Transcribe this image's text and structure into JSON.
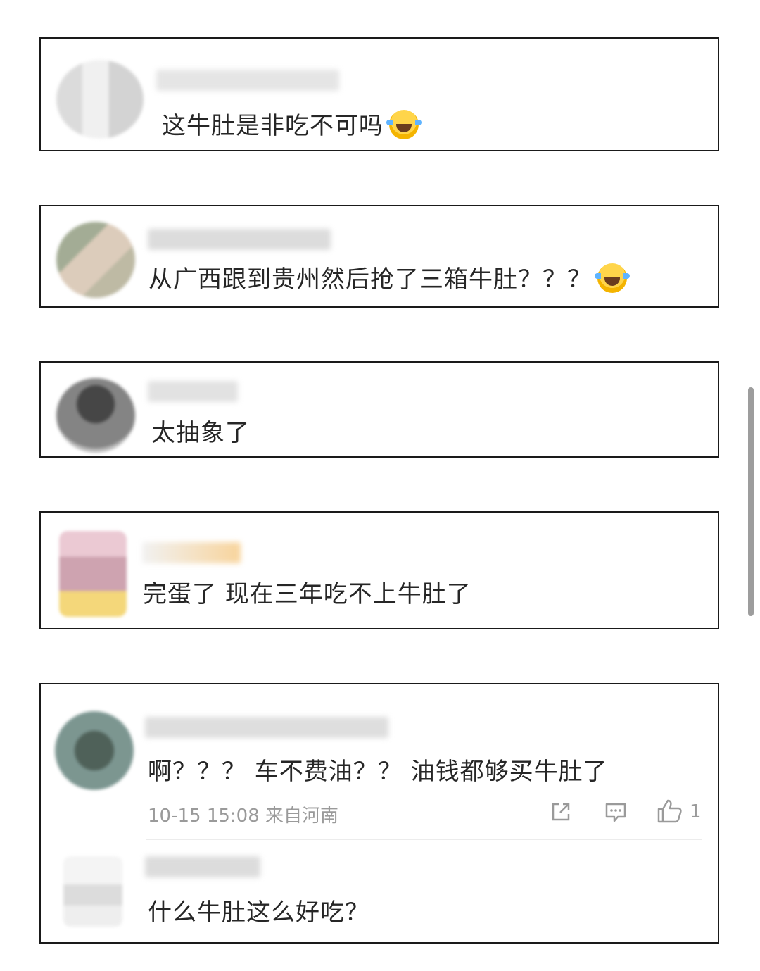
{
  "comments": [
    {
      "text": "这牛肚是非吃不可吗",
      "emoji": "laugh-cry-emoji"
    },
    {
      "text": "从广西跟到贵州然后抢了三箱牛肚？？？",
      "emoji": "laugh-cry-emoji"
    },
    {
      "text": "太抽象了"
    },
    {
      "text": "完蛋了 现在三年吃不上牛肚了"
    },
    {
      "text": "啊？？？ 车不费油？？ 油钱都够买牛肚了",
      "meta": "10-15 15:08 来自河南",
      "like_count": "1"
    },
    {
      "text": "什么牛肚这么好吃？"
    }
  ],
  "colors": {
    "border": "#1a1a1a",
    "meta": "#9a9a9a",
    "emoji": "#ffd54a"
  }
}
